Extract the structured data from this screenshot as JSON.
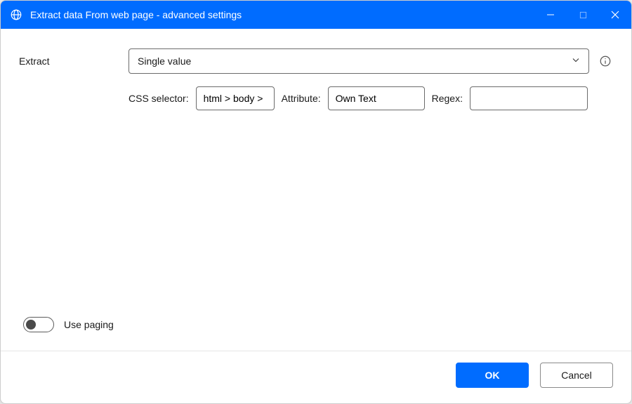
{
  "window": {
    "title": "Extract data From web page - advanced settings"
  },
  "form": {
    "extract_label": "Extract",
    "extract_value": "Single value",
    "css_selector_label": "CSS selector:",
    "css_selector_value": "html > body >",
    "attribute_label": "Attribute:",
    "attribute_value": "Own Text",
    "regex_label": "Regex:",
    "regex_value": ""
  },
  "paging": {
    "label": "Use paging",
    "enabled": false
  },
  "footer": {
    "ok": "OK",
    "cancel": "Cancel"
  }
}
